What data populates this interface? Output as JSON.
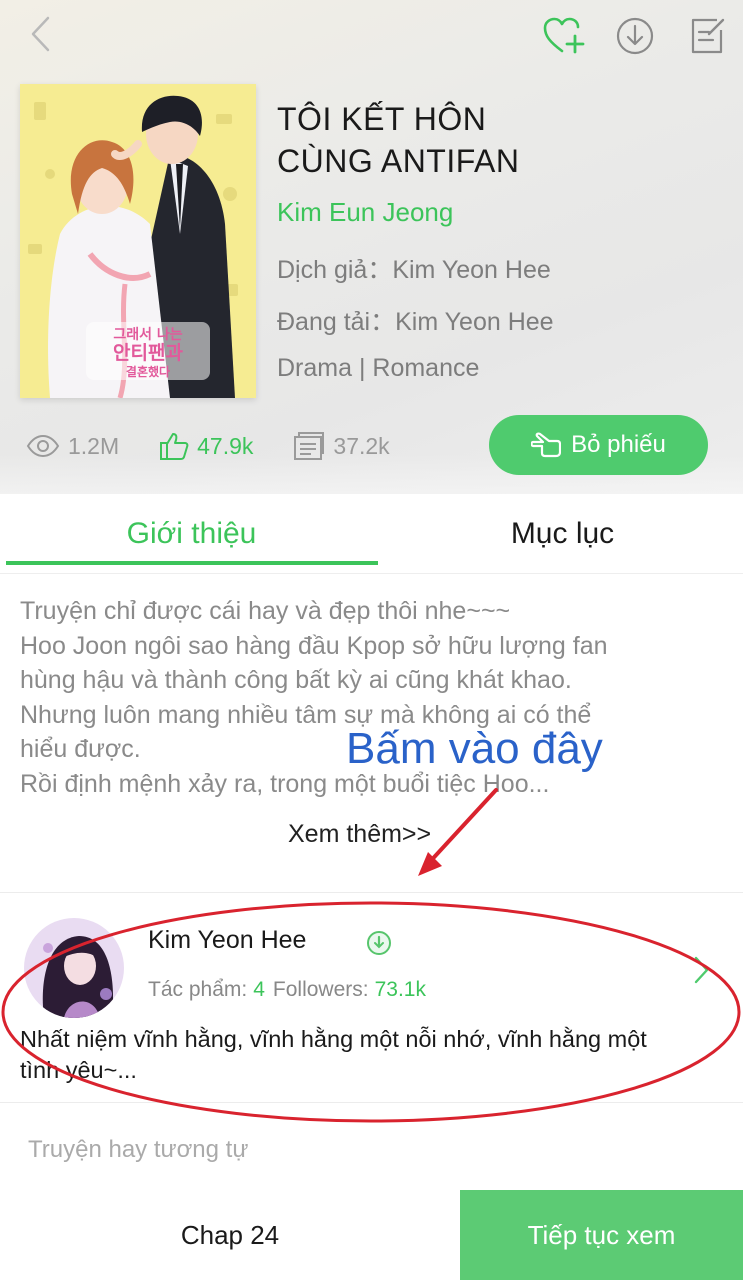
{
  "header": {
    "back_icon": "chevron-left-icon",
    "favorite_icon": "heart-plus-icon",
    "download_icon": "download-icon",
    "edit_icon": "edit-icon"
  },
  "book": {
    "cover_text": [
      "그래서 나는",
      "안티팬과",
      "결혼했다"
    ],
    "title_line1": "TÔI KẾT HÔN",
    "title_line2": "CÙNG ANTIFAN",
    "author": "Kim Eun Jeong",
    "translator": "Dịch giả：Kim Yeon Hee",
    "uploader": "Đang tải：Kim Yeon Hee",
    "genres": "Drama | Romance"
  },
  "stats": {
    "views": "1.2M",
    "likes": "47.9k",
    "comments": "37.2k"
  },
  "vote_button": "Bỏ phiếu",
  "tabs": {
    "intro": "Giới thiệu",
    "toc": "Mục lục"
  },
  "description": {
    "lines": [
      "Truyện chỉ được cái hay và đẹp thôi nhe~~~",
      "Hoo Joon ngôi sao hàng đầu Kpop sở hữu lượng fan",
      "hùng hậu và thành công bất kỳ ai cũng khát khao.",
      "Nhưng luôn mang nhiều tâm sự mà không ai có thể",
      "hiểu được.",
      "Rồi định mệnh xảy ra, trong một buổi tiệc Hoo..."
    ],
    "more": "Xem thêm>>"
  },
  "annotation": {
    "hint": "Bấm vào đây",
    "color": "#2a62c9",
    "ellipse_color": "#d9232e"
  },
  "uploader_card": {
    "name": "Kim Yeon Hee",
    "works_label": "Tác phẩm:",
    "works": "4",
    "followers_label": "Followers:",
    "followers": "73.1k",
    "bio_line1": "Nhất niệm vĩnh hằng, vĩnh hằng một nỗi nhớ, vĩnh hằng một",
    "bio_line2": "tình yêu~..."
  },
  "similar_heading": "Truyện hay tương tự",
  "bottom": {
    "chapter": "Chap 24",
    "continue": "Tiếp tục xem"
  },
  "colors": {
    "accent": "#3cc45a",
    "button": "#4fcb6e",
    "continue": "#5ccb74"
  }
}
